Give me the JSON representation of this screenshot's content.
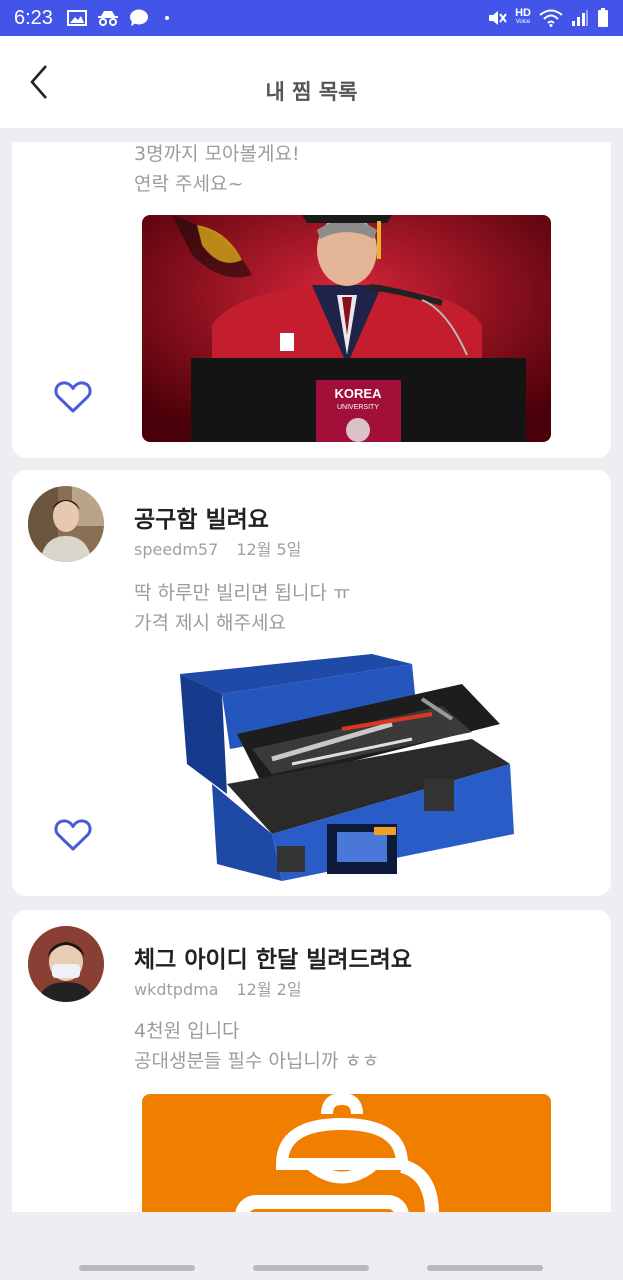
{
  "status_bar": {
    "time": "6:23",
    "hd_label": "HD",
    "voice_label": "Voice",
    "icons": [
      "image-icon",
      "incognito-icon",
      "chat-bubble-icon",
      "dot-icon",
      "mute-icon",
      "wifi-icon",
      "signal-icon",
      "battery-icon"
    ]
  },
  "header": {
    "title": "내 찜 목록",
    "back_icon": "chevron-left-icon"
  },
  "posts": [
    {
      "body_lines": [
        "3명까지 모아볼게요!",
        "연락 주세요~"
      ],
      "image": "graduation-speech-photo",
      "favorited_icon": "heart-outline-icon"
    },
    {
      "title": "공구함 빌려요",
      "author": "speedm57",
      "date": "12월 5일",
      "body_lines": [
        "딱 하루만 빌리면 됩니다 ㅠ",
        "가격 제시 해주세요"
      ],
      "image": "toolbox-photo",
      "favorited_icon": "heart-outline-icon"
    },
    {
      "title": "체그 아이디 한달 빌려드려요",
      "author": "wkdtpdma",
      "date": "12월 2일",
      "body_lines": [
        "4천원 입니다",
        "공대생분들 필수 아닙니까 ㅎㅎ"
      ],
      "image": "study-lamp-logo"
    }
  ],
  "colors": {
    "accent": "#4355e8",
    "heart": "#4a5bd6",
    "background": "#eeeef2",
    "orange": "#f07f00"
  }
}
